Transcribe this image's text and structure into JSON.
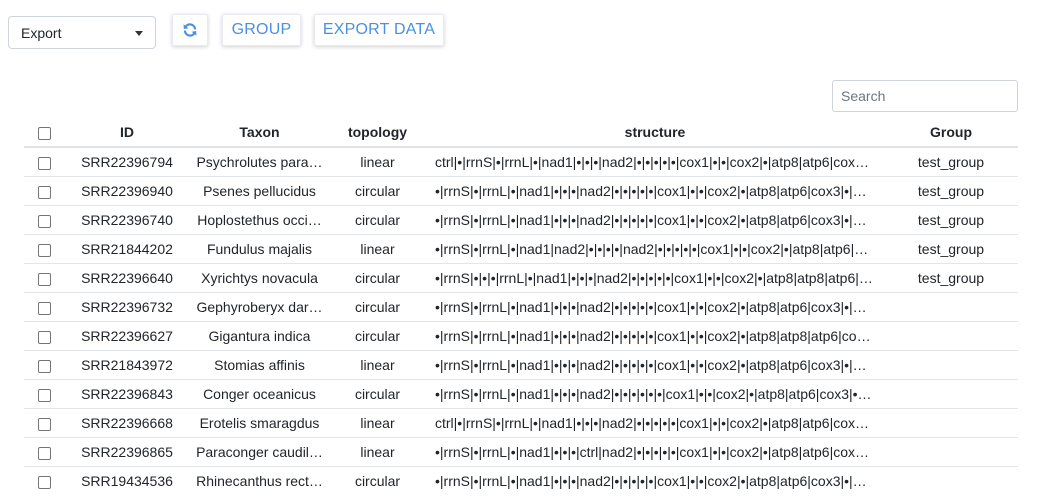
{
  "toolbar": {
    "select_value": "Export",
    "refresh_icon": "refresh-icon",
    "group_label": "GROUP",
    "export_label": "EXPORT DATA"
  },
  "search": {
    "placeholder": "Search"
  },
  "colors": {
    "accent": "#4a90e2"
  },
  "table": {
    "headers": {
      "id": "ID",
      "taxon": "Taxon",
      "topology": "topology",
      "structure": "structure",
      "group": "Group"
    },
    "rows": [
      {
        "id": "SRR22396794",
        "taxon": "Psychrolutes para…",
        "topology": "linear",
        "structure": "ctrl|•|rrnS|•|rrnL|•|nad1|•|•|•|nad2|•|•|•|•|•|cox1|•|•|cox2|•|atp8|atp6|cox…",
        "group": "test_group"
      },
      {
        "id": "SRR22396940",
        "taxon": "Psenes pellucidus",
        "topology": "circular",
        "structure": "•|rrnS|•|rrnL|•|nad1|•|•|•|nad2|•|•|•|•|•|cox1|•|•|cox2|•|atp8|atp6|cox3|•|…",
        "group": "test_group"
      },
      {
        "id": "SRR22396740",
        "taxon": "Hoplostethus occi…",
        "topology": "circular",
        "structure": "•|rrnS|•|rrnL|•|nad1|•|•|•|nad2|•|•|•|•|•|cox1|•|•|cox2|•|atp8|atp6|cox3|•|…",
        "group": "test_group"
      },
      {
        "id": "SRR21844202",
        "taxon": "Fundulus majalis",
        "topology": "linear",
        "structure": "•|rrnS|•|rrnL|•|nad1|nad2|•|•|•|•|nad2|•|•|•|•|•|cox1|•|•|cox2|•|atp8|atp6|…",
        "group": "test_group"
      },
      {
        "id": "SRR22396640",
        "taxon": "Xyrichtys novacula",
        "topology": "circular",
        "structure": "•|rrnS|•|•|•|rrnL|•|nad1|•|•|•|nad2|•|•|•|•|•|cox1|•|•|cox2|•|atp8|atp8|atp6|…",
        "group": "test_group"
      },
      {
        "id": "SRR22396732",
        "taxon": "Gephyroberyx dar…",
        "topology": "circular",
        "structure": "•|rrnS|•|rrnL|•|nad1|•|•|•|nad2|•|•|•|•|•|cox1|•|•|cox2|•|atp8|atp6|cox3|•|…",
        "group": ""
      },
      {
        "id": "SRR22396627",
        "taxon": "Gigantura indica",
        "topology": "circular",
        "structure": "•|rrnS|•|rrnL|•|nad1|•|•|•|nad2|•|•|•|•|•|cox1|•|•|cox2|•|atp8|atp8|atp6|co…",
        "group": ""
      },
      {
        "id": "SRR21843972",
        "taxon": "Stomias affinis",
        "topology": "linear",
        "structure": "•|rrnS|•|rrnL|•|nad1|•|•|•|nad2|•|•|•|•|•|cox1|•|•|cox2|•|atp8|atp6|cox3|•|…",
        "group": ""
      },
      {
        "id": "SRR22396843",
        "taxon": "Conger oceanicus",
        "topology": "circular",
        "structure": "•|rrnS|•|rrnL|•|nad1|•|•|•|nad2|•|•|•|•|•|•|cox1|•|•|cox2|•|atp8|atp6|cox3|•…",
        "group": ""
      },
      {
        "id": "SRR22396668",
        "taxon": "Erotelis smaragdus",
        "topology": "linear",
        "structure": "ctrl|•|rrnS|•|rrnL|•|nad1|•|•|•|nad2|•|•|•|•|•|cox1|•|•|cox2|•|atp8|atp6|cox…",
        "group": ""
      },
      {
        "id": "SRR22396865",
        "taxon": "Paraconger caudil…",
        "topology": "linear",
        "structure": "•|rrnS|•|rrnL|•|nad1|•|•|•|ctrl|nad2|•|•|•|•|•|cox1|•|•|cox2|•|atp8|atp6|cox…",
        "group": ""
      },
      {
        "id": "SRR19434536",
        "taxon": "Rhinecanthus rect…",
        "topology": "circular",
        "structure": "•|rrnS|•|rrnL|•|nad1|•|•|•|nad2|•|•|•|•|•|cox1|•|•|cox2|•|atp8|atp6|cox3|•|…",
        "group": ""
      }
    ]
  }
}
